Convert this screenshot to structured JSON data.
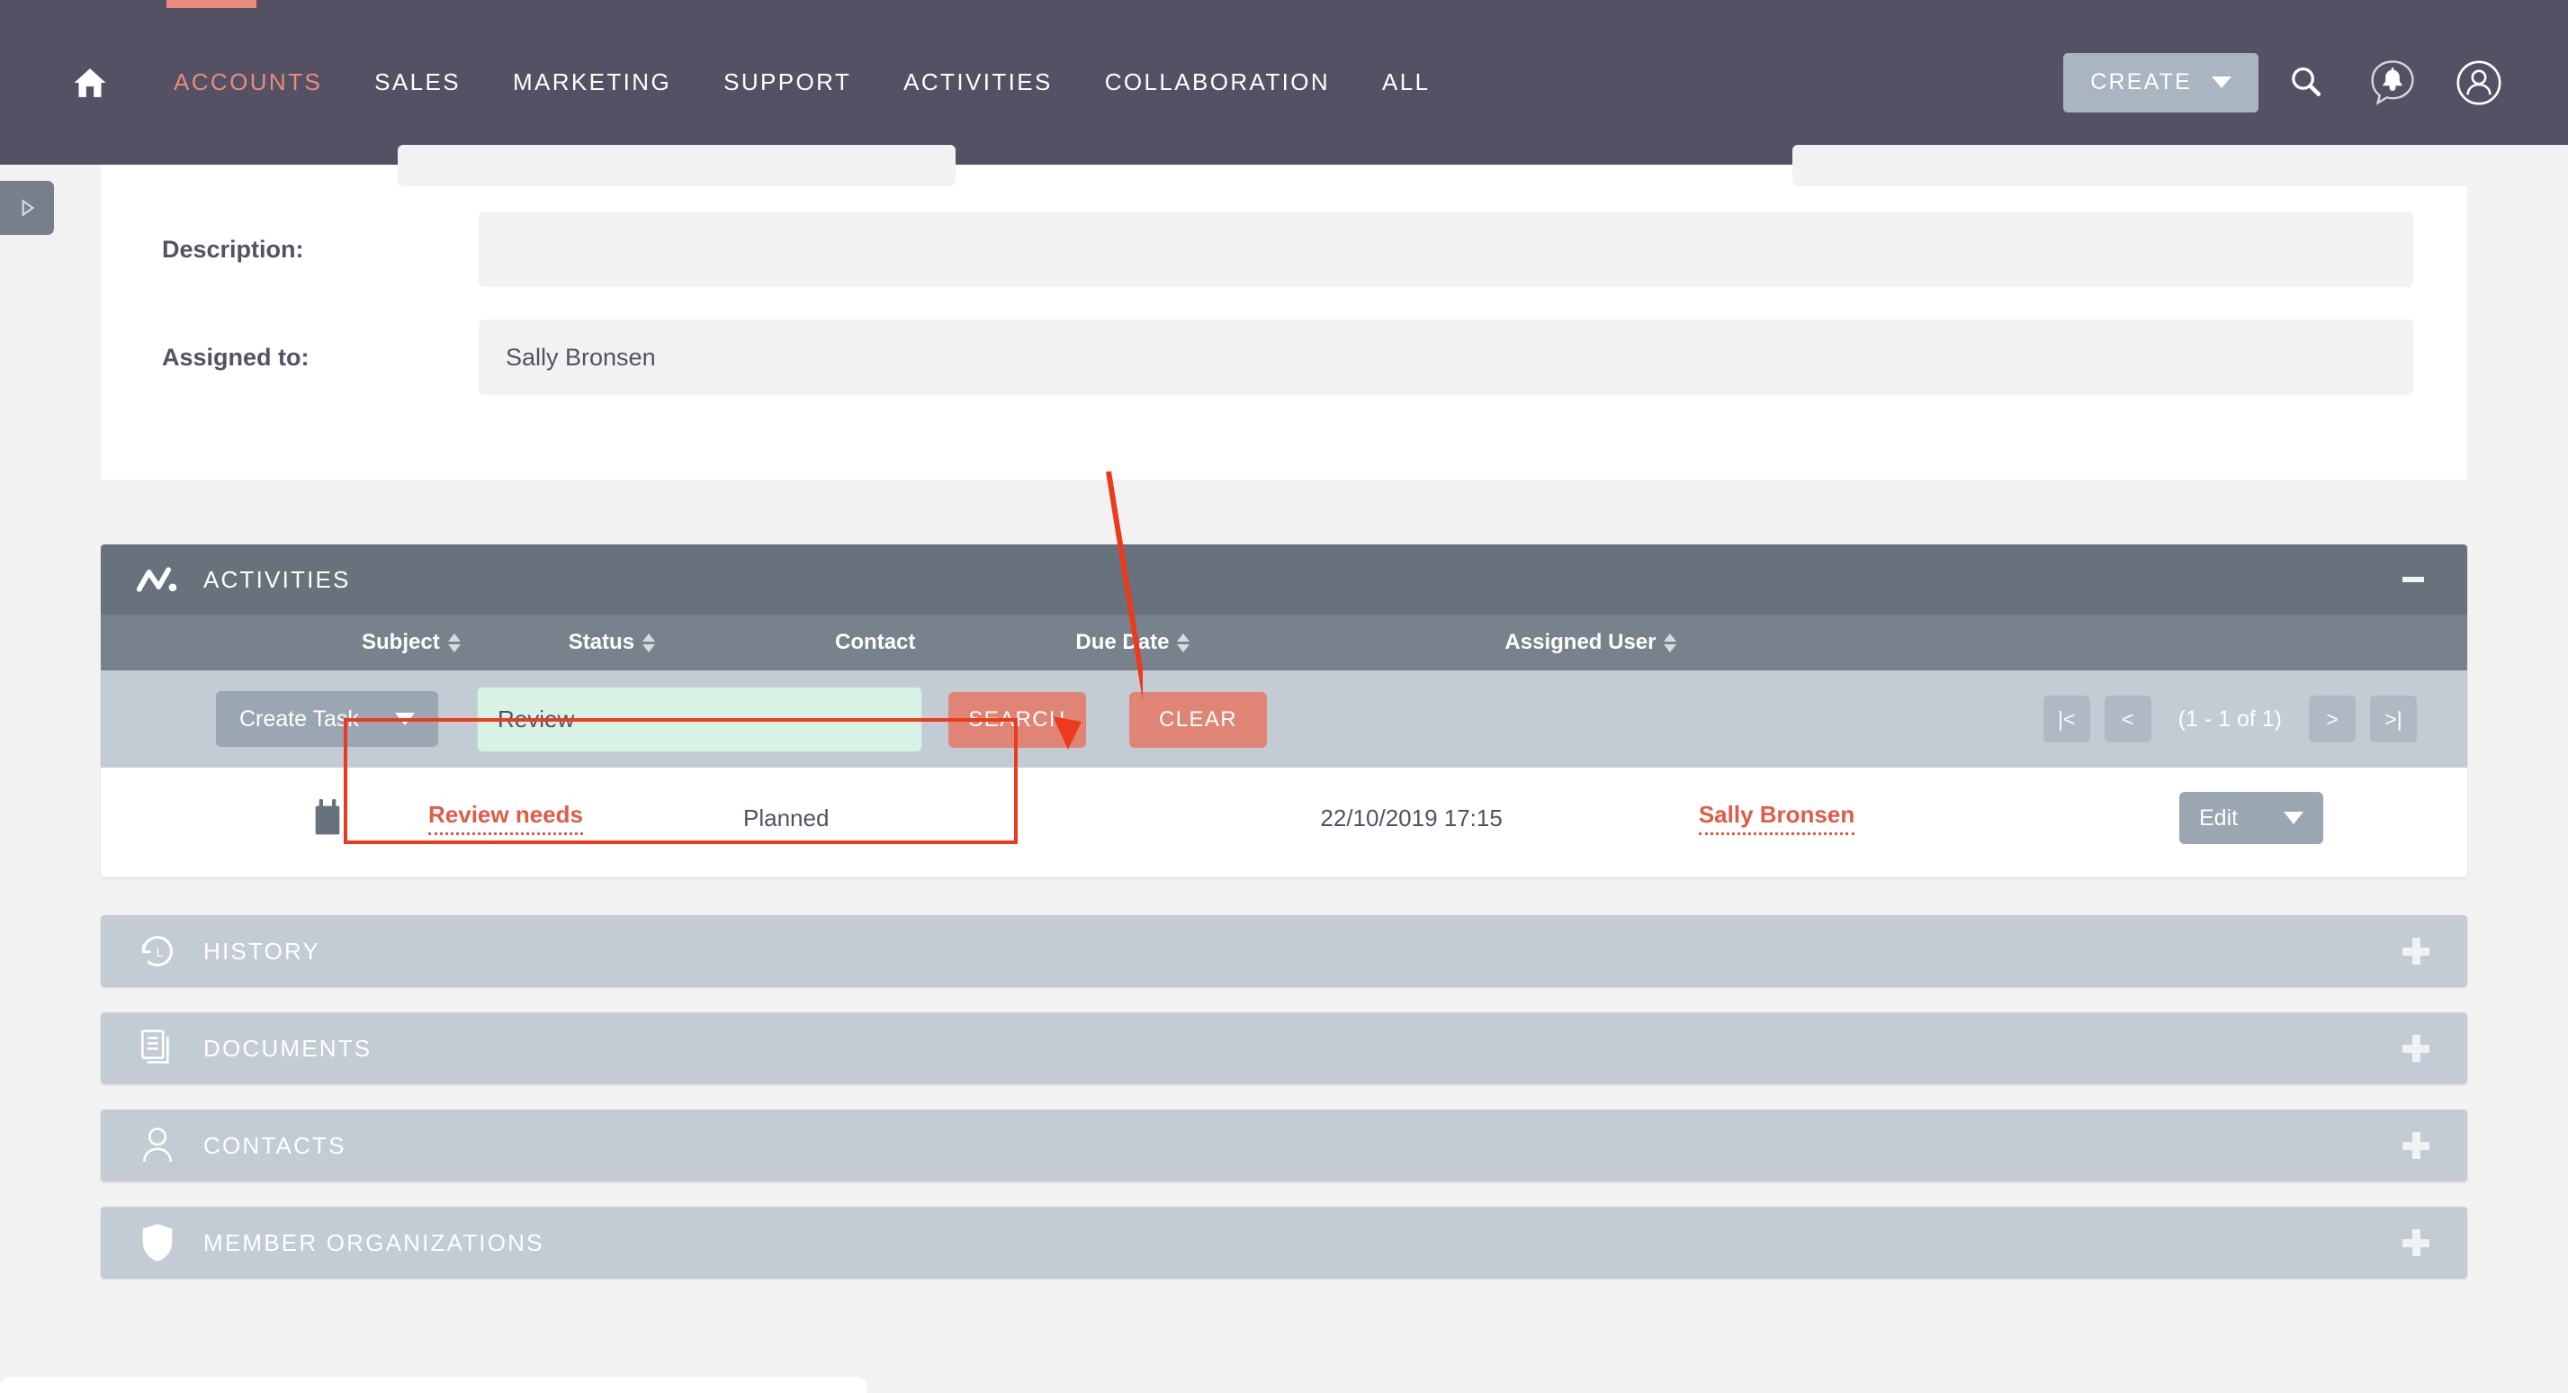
{
  "navbar": {
    "home_icon": "home-icon",
    "links": [
      {
        "label": "ACCOUNTS",
        "active": true
      },
      {
        "label": "SALES",
        "active": false
      },
      {
        "label": "MARKETING",
        "active": false
      },
      {
        "label": "SUPPORT",
        "active": false
      },
      {
        "label": "ACTIVITIES",
        "active": false
      },
      {
        "label": "COLLABORATION",
        "active": false
      },
      {
        "label": "ALL",
        "active": false
      }
    ],
    "create_button": "CREATE",
    "search_icon": "search-icon",
    "notifications_icon": "speech-bubble-bell-icon",
    "profile_icon": "user-circle-icon",
    "accent_color": "#e98b7c",
    "background_color": "#545165"
  },
  "sidebar_toggle": {
    "icon": "play-triangle-icon"
  },
  "detail_form": {
    "fields": [
      {
        "label": "Description:",
        "value": ""
      },
      {
        "label": "Assigned to:",
        "value": "Sally Bronsen"
      }
    ]
  },
  "activities_panel": {
    "icon": "activity-chart-icon",
    "title": "ACTIVITIES",
    "toggle_icon": "minus-icon",
    "columns": [
      {
        "label": "Subject",
        "sortable": true
      },
      {
        "label": "Status",
        "sortable": true
      },
      {
        "label": "Contact",
        "sortable": false
      },
      {
        "label": "Due Date",
        "sortable": true
      },
      {
        "label": "Assigned User",
        "sortable": true
      }
    ],
    "toolbar": {
      "create_task_label": "Create Task",
      "search_value": "Review",
      "search_button": "SEARCH",
      "clear_button": "CLEAR",
      "pager": {
        "first": "|<",
        "prev": "<",
        "count": "(1 - 1 of 1)",
        "next": ">",
        "last": ">|"
      }
    },
    "rows": [
      {
        "type_icon": "task-clipboard-icon",
        "subject": "Review needs",
        "status": "Planned",
        "contact": "",
        "due_date": "22/10/2019 17:15",
        "assigned_user": "Sally Bronsen",
        "action": "Edit"
      }
    ]
  },
  "collapsed_panels": [
    {
      "icon": "history-clock-icon",
      "title": "HISTORY",
      "toggle_icon": "plus-icon"
    },
    {
      "icon": "documents-icon",
      "title": "DOCUMENTS",
      "toggle_icon": "plus-icon"
    },
    {
      "icon": "contacts-person-icon",
      "title": "CONTACTS",
      "toggle_icon": "plus-icon"
    },
    {
      "icon": "shield-icon",
      "title": "MEMBER ORGANIZATIONS",
      "toggle_icon": "plus-icon"
    }
  ],
  "annotation": {
    "highlight_color": "#ec3b1c",
    "target": "search-area"
  }
}
